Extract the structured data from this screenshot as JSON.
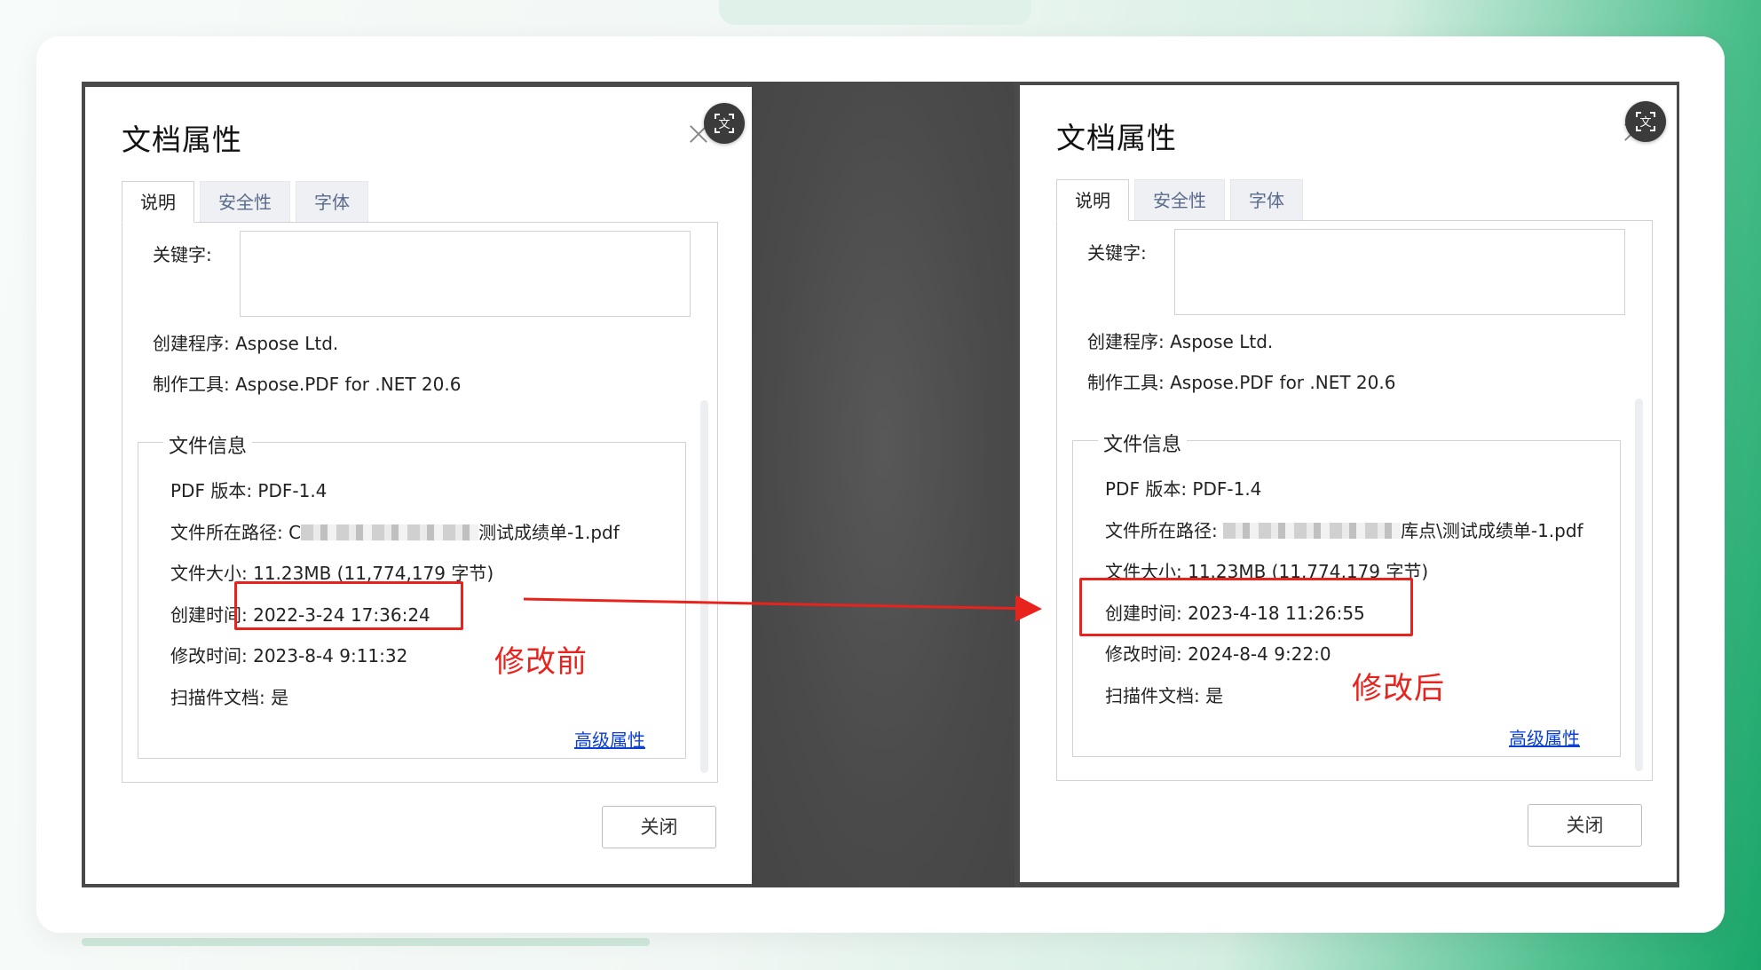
{
  "dialogs": {
    "left": {
      "title": "文档属性",
      "tabs": [
        "说明",
        "安全性",
        "字体"
      ],
      "keywords_label": "关键字:",
      "creator": "创建程序: Aspose Ltd.",
      "producer": "制作工具: Aspose.PDF for .NET 20.6",
      "file_info_legend": "文件信息",
      "pdf_version": "PDF 版本: PDF-1.4",
      "path_prefix": "文件所在路径: C",
      "path_suffix": "测试成绩单-1.pdf",
      "file_size": "文件大小: 11.23MB (11,774,179 字节)",
      "created": "创建时间: 2022-3-24 17:36:24",
      "modified": "修改时间: 2023-8-4 9:11:32",
      "scanned": "扫描件文档: 是",
      "advanced": "高级属性",
      "close": "关闭"
    },
    "right": {
      "title": "文档属性",
      "tabs": [
        "说明",
        "安全性",
        "字体"
      ],
      "keywords_label": "关键字:",
      "creator": "创建程序: Aspose Ltd.",
      "producer": "制作工具: Aspose.PDF for .NET 20.6",
      "file_info_legend": "文件信息",
      "pdf_version": "PDF 版本: PDF-1.4",
      "path_prefix": "文件所在路径: ",
      "path_suffix": "库点\\测试成绩单-1.pdf",
      "file_size": "文件大小: 11.23MB (11,774,179 字节)",
      "created": "创建时间: 2023-4-18 11:26:55",
      "modified": "修改时间: 2024-8-4 9:22:0",
      "scanned": "扫描件文档: 是",
      "advanced": "高级属性",
      "close": "关闭"
    }
  },
  "annotations": {
    "before": "修改前",
    "after": "修改后",
    "color": "#e8231d"
  },
  "icons": {
    "translate": "translate-icon",
    "close": "close-icon"
  }
}
